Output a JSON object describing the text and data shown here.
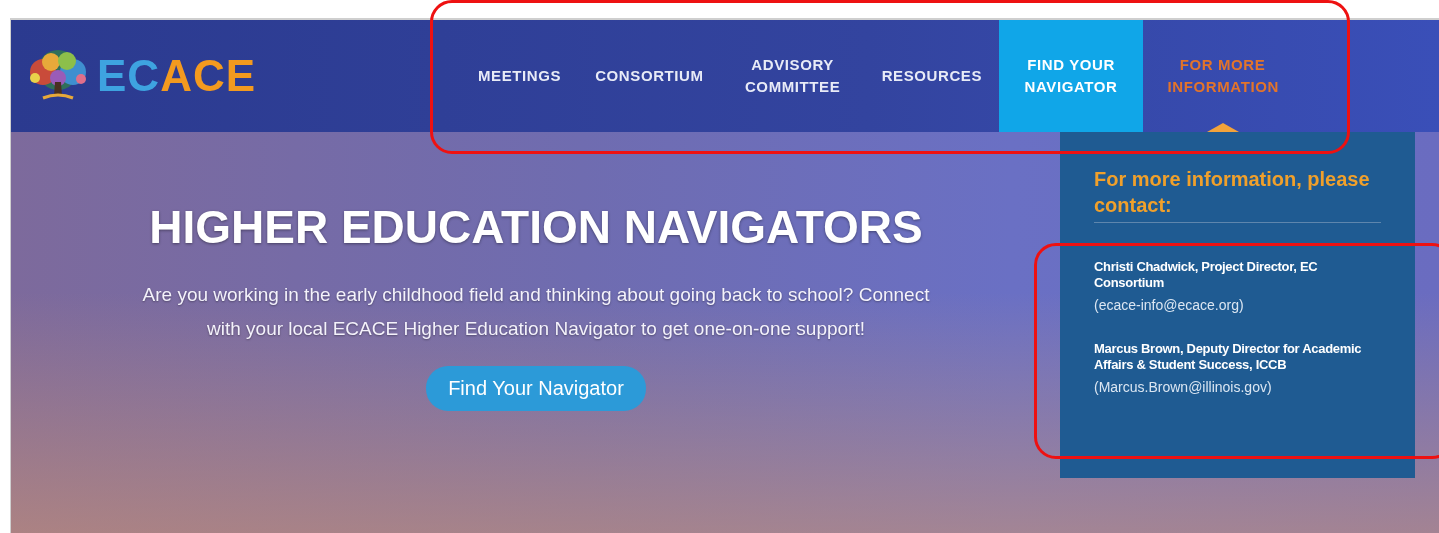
{
  "logo": {
    "text_start": "EC",
    "text_end": "ACE"
  },
  "nav": [
    {
      "label": "MEETINGS",
      "kind": "link"
    },
    {
      "label": "CONSORTIUM",
      "kind": "link"
    },
    {
      "label": "ADVISORY COMMITTEE",
      "kind": "link"
    },
    {
      "label": "RESOURCES",
      "kind": "link"
    },
    {
      "label": "FIND YOUR NAVIGATOR",
      "kind": "cta"
    },
    {
      "label": "FOR MORE INFORMATION",
      "kind": "dropdown"
    }
  ],
  "dropdown": {
    "expanded": true,
    "heading": "For more information, please contact:",
    "contacts": [
      {
        "name": "Christi Chadwick, Project Director, EC Consortium",
        "email": "(ecace-info@ecace.org)"
      },
      {
        "name": "Marcus Brown, Deputy Director for Academic Affairs & Student Success, ICCB",
        "email": "(Marcus.Brown@illinois.gov)"
      }
    ]
  },
  "hero": {
    "title": "HIGHER EDUCATION NAVIGATORS",
    "text": "Are you working in the early childhood field and thinking about going back to school? Connect with your local ECACE Higher Education Navigator to get one-on-one support!",
    "button": "Find Your Navigator"
  }
}
